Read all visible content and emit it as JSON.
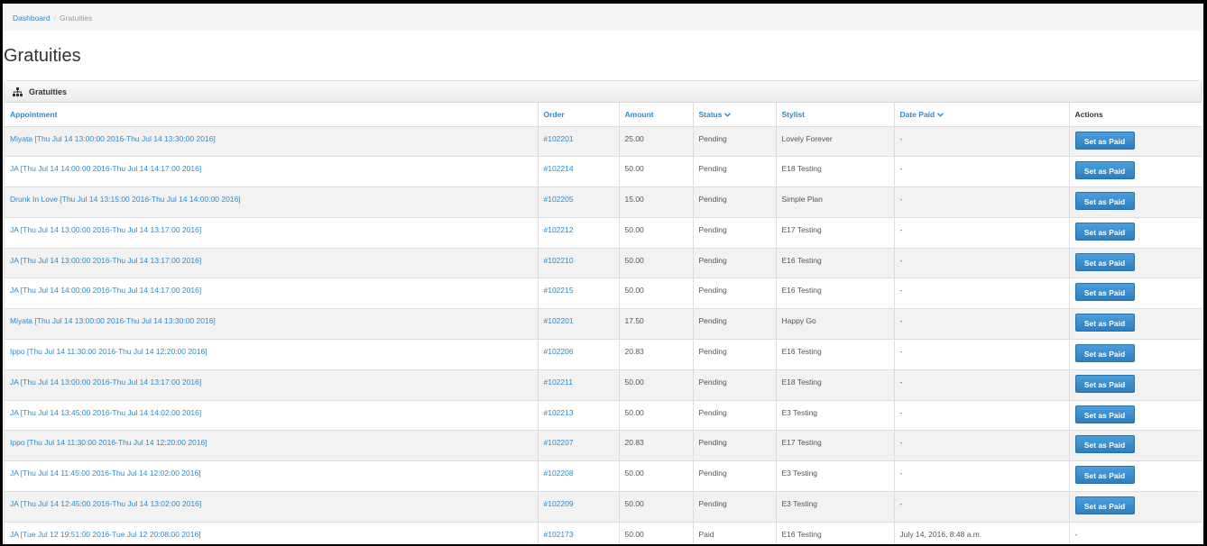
{
  "breadcrumb": {
    "home": "Dashboard",
    "current": "Gratuities"
  },
  "page_title": "Gratuities",
  "panel_title": "Gratuities",
  "columns": {
    "appointment": "Appointment",
    "order": "Order",
    "amount": "Amount",
    "status": "Status",
    "stylist": "Stylist",
    "date_paid": "Date Paid",
    "actions": "Actions"
  },
  "rows": [
    {
      "appointment": "Miyata [Thu Jul 14 13:00:00 2016-Thu Jul 14 13:30:00 2016]",
      "order": "#102201",
      "amount": "25.00",
      "status": "Pending",
      "stylist": "Lovely Forever",
      "date_paid": "-",
      "action": "Set as Paid"
    },
    {
      "appointment": "JA [Thu Jul 14 14:00:00 2016-Thu Jul 14 14:17:00 2016]",
      "order": "#102214",
      "amount": "50.00",
      "status": "Pending",
      "stylist": "E18 Testing",
      "date_paid": "-",
      "action": "Set as Paid"
    },
    {
      "appointment": "Drunk In Love [Thu Jul 14 13:15:00 2016-Thu Jul 14 14:00:00 2016]",
      "order": "#102205",
      "amount": "15.00",
      "status": "Pending",
      "stylist": "Simple Plan",
      "date_paid": "-",
      "action": "Set as Paid"
    },
    {
      "appointment": "JA [Thu Jul 14 13:00:00 2016-Thu Jul 14 13:17:00 2016]",
      "order": "#102212",
      "amount": "50.00",
      "status": "Pending",
      "stylist": "E17 Testing",
      "date_paid": "-",
      "action": "Set as Paid"
    },
    {
      "appointment": "JA [Thu Jul 14 13:00:00 2016-Thu Jul 14 13:17:00 2016]",
      "order": "#102210",
      "amount": "50.00",
      "status": "Pending",
      "stylist": "E16 Testing",
      "date_paid": "-",
      "action": "Set as Paid"
    },
    {
      "appointment": "JA [Thu Jul 14 14:00:00 2016-Thu Jul 14 14:17:00 2016]",
      "order": "#102215",
      "amount": "50.00",
      "status": "Pending",
      "stylist": "E16 Testing",
      "date_paid": "-",
      "action": "Set as Paid"
    },
    {
      "appointment": "Miyata [Thu Jul 14 13:00:00 2016-Thu Jul 14 13:30:00 2016]",
      "order": "#102201",
      "amount": "17.50",
      "status": "Pending",
      "stylist": "Happy Go",
      "date_paid": "-",
      "action": "Set as Paid"
    },
    {
      "appointment": "Ippo [Thu Jul 14 11:30:00 2016-Thu Jul 14 12:20:00 2016]",
      "order": "#102206",
      "amount": "20.83",
      "status": "Pending",
      "stylist": "E16 Testing",
      "date_paid": "-",
      "action": "Set as Paid"
    },
    {
      "appointment": "JA [Thu Jul 14 13:00:00 2016-Thu Jul 14 13:17:00 2016]",
      "order": "#102211",
      "amount": "50.00",
      "status": "Pending",
      "stylist": "E18 Testing",
      "date_paid": "-",
      "action": "Set as Paid"
    },
    {
      "appointment": "JA [Thu Jul 14 13:45:00 2016-Thu Jul 14 14:02:00 2016]",
      "order": "#102213",
      "amount": "50.00",
      "status": "Pending",
      "stylist": "E3 Testing",
      "date_paid": "-",
      "action": "Set as Paid"
    },
    {
      "appointment": "Ippo [Thu Jul 14 11:30:00 2016-Thu Jul 14 12:20:00 2016]",
      "order": "#102207",
      "amount": "20.83",
      "status": "Pending",
      "stylist": "E17 Testing",
      "date_paid": "-",
      "action": "Set as Paid"
    },
    {
      "appointment": "JA [Thu Jul 14 11:45:00 2016-Thu Jul 14 12:02:00 2016]",
      "order": "#102208",
      "amount": "50.00",
      "status": "Pending",
      "stylist": "E3 Testing",
      "date_paid": "-",
      "action": "Set as Paid"
    },
    {
      "appointment": "JA [Thu Jul 14 12:45:00 2016-Thu Jul 14 13:02:00 2016]",
      "order": "#102209",
      "amount": "50.00",
      "status": "Pending",
      "stylist": "E3 Testing",
      "date_paid": "-",
      "action": "Set as Paid"
    },
    {
      "appointment": "JA [Tue Jul 12 19:51:00 2016-Tue Jul 12 20:08:00 2016]",
      "order": "#102173",
      "amount": "50.00",
      "status": "Paid",
      "stylist": "E16 Testing",
      "date_paid": "July 14, 2016, 8:48 a.m.",
      "action": "-"
    }
  ],
  "colors": {
    "link": "#2a8cc9",
    "button": "#2d7fc0",
    "stripe": "#f2f2f2"
  },
  "icons": {
    "panel": "sitemap-icon",
    "sort": "chevron-down-icon"
  }
}
